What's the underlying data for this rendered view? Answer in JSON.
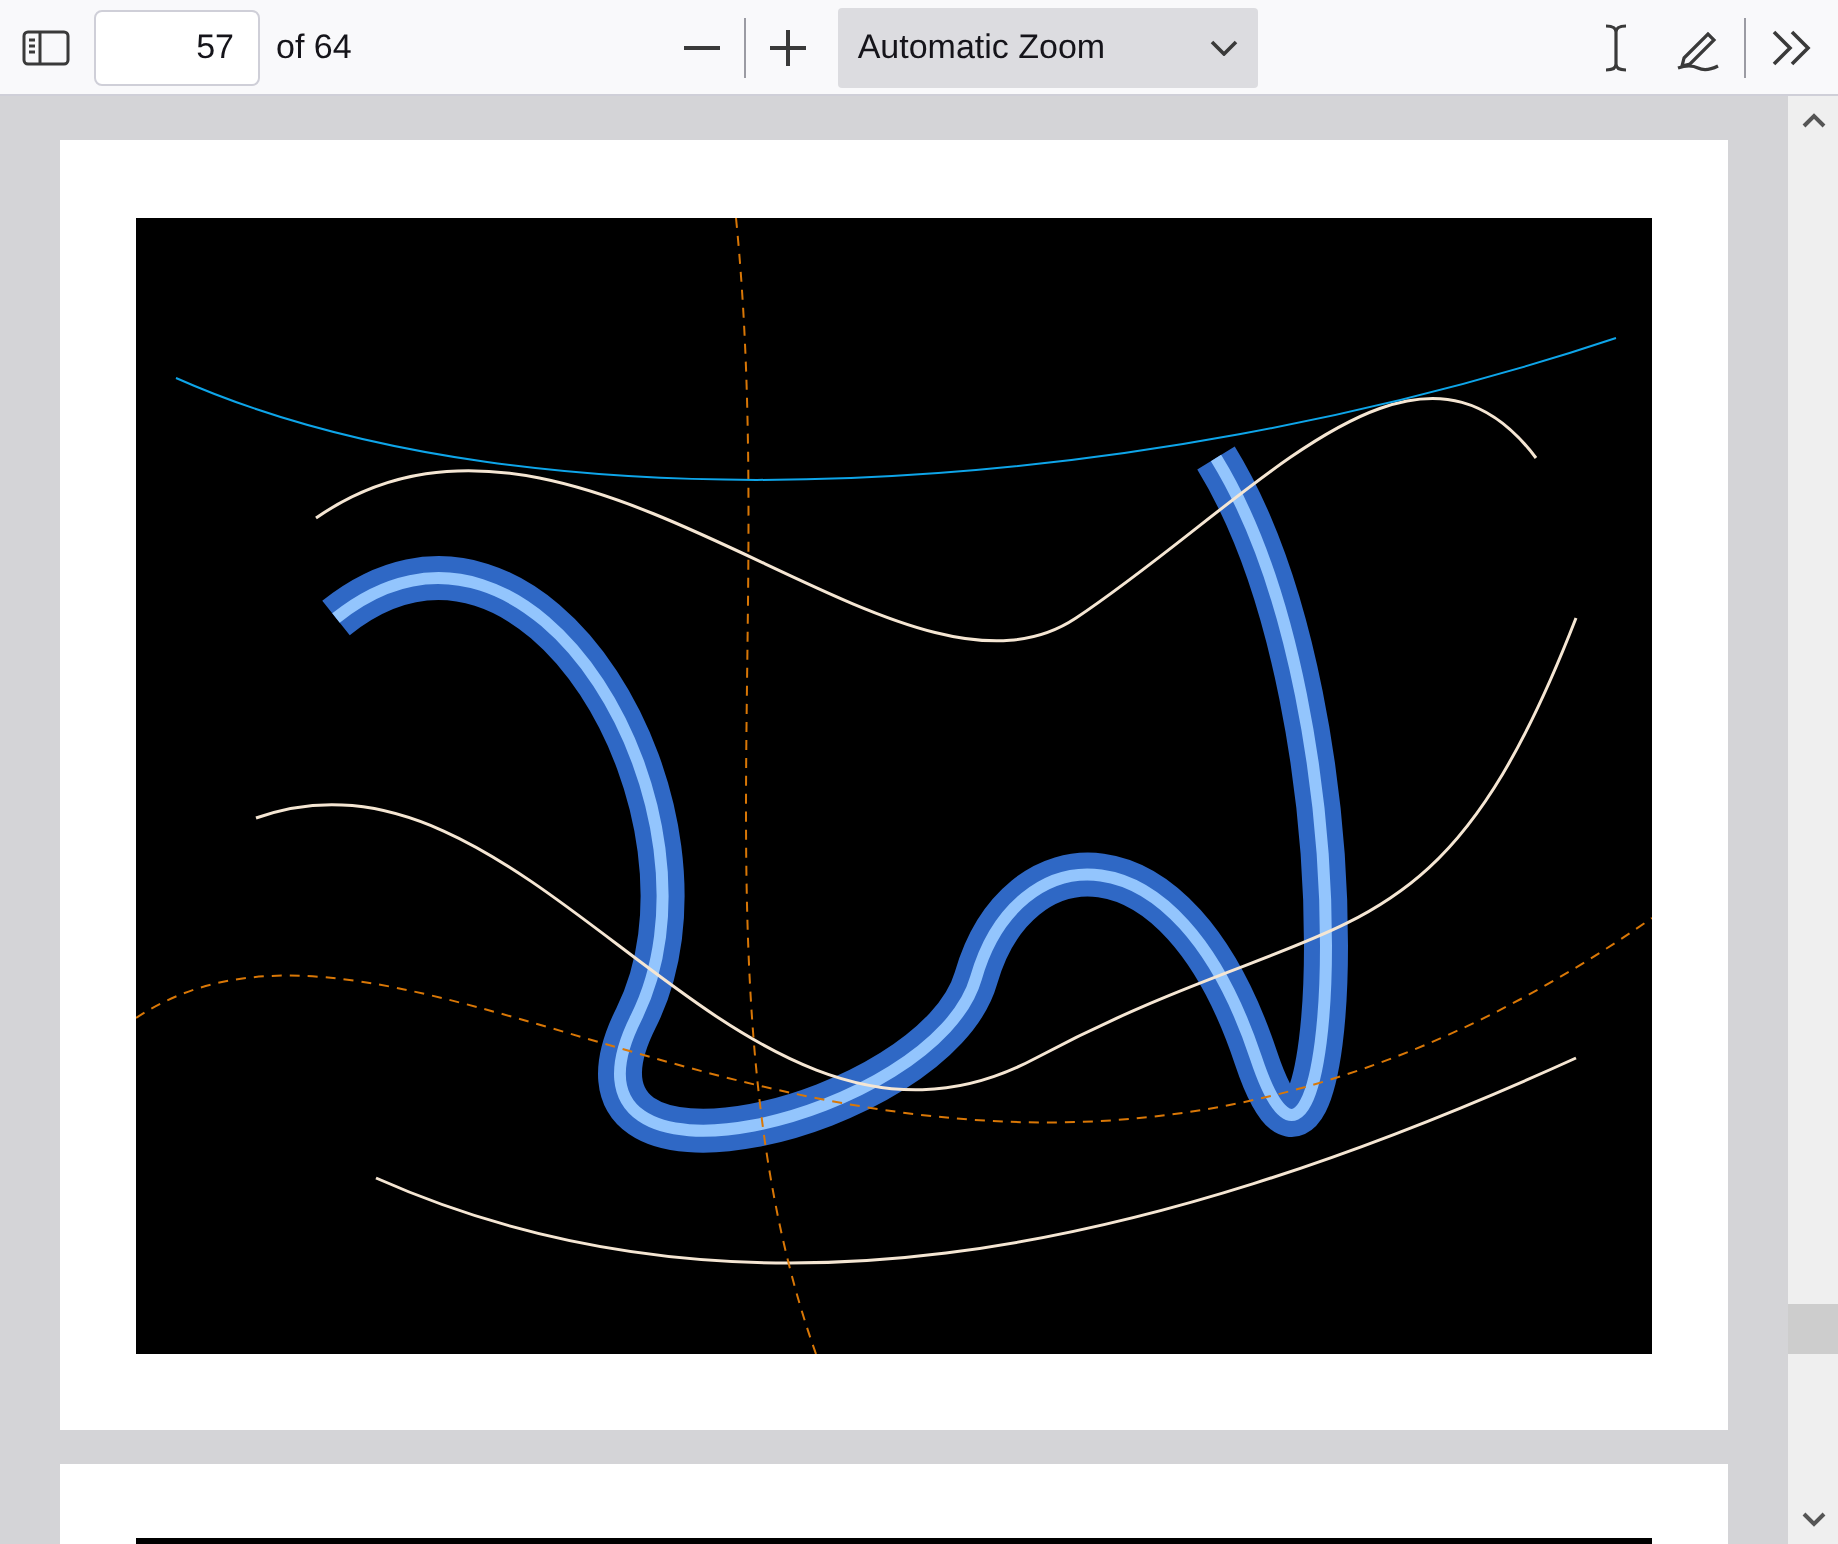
{
  "toolbar": {
    "page_number": "57",
    "page_count": "of 64",
    "zoom_select": "Automatic Zoom"
  }
}
